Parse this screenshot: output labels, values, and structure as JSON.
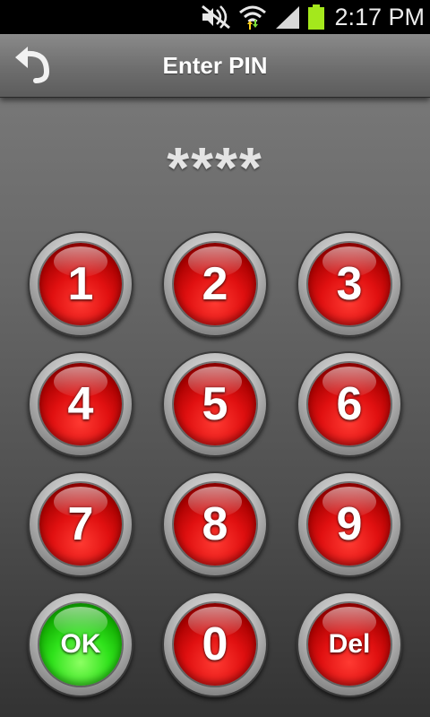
{
  "status_bar": {
    "time": "2:17 PM",
    "icons": [
      "silent-mode-icon",
      "wifi-icon",
      "signal-icon",
      "battery-icon"
    ],
    "battery_color": "#a4e81c"
  },
  "header": {
    "title": "Enter PIN",
    "back_icon": "back-arrow-icon"
  },
  "pin": {
    "masked_value": "****"
  },
  "keypad": {
    "keys": [
      {
        "label": "1",
        "color": "#e01010"
      },
      {
        "label": "2",
        "color": "#e01010"
      },
      {
        "label": "3",
        "color": "#e01010"
      },
      {
        "label": "4",
        "color": "#e01010"
      },
      {
        "label": "5",
        "color": "#e01010"
      },
      {
        "label": "6",
        "color": "#e01010"
      },
      {
        "label": "7",
        "color": "#e01010"
      },
      {
        "label": "8",
        "color": "#e01010"
      },
      {
        "label": "9",
        "color": "#e01010"
      },
      {
        "label": "OK",
        "color": "#2fe21b"
      },
      {
        "label": "0",
        "color": "#e01010"
      },
      {
        "label": "Del",
        "color": "#e01010"
      }
    ]
  }
}
